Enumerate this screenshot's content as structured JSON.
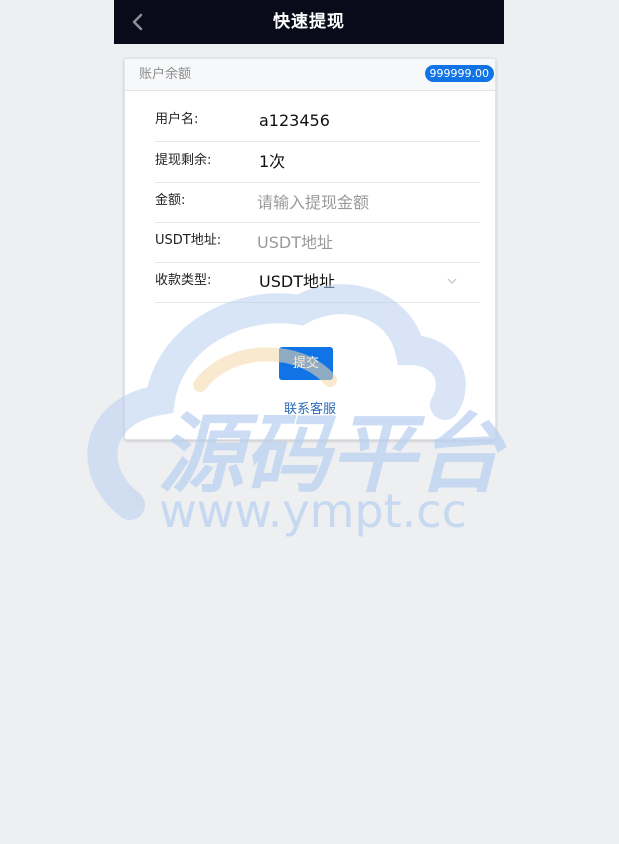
{
  "header": {
    "title": "快速提现",
    "back_icon": "chevron-left-icon"
  },
  "card": {
    "header_label": "账户余额",
    "balance": "999999.00"
  },
  "form": {
    "username": {
      "label": "用户名:",
      "value": "a123456"
    },
    "remaining": {
      "label": "提现剩余:",
      "value": "1次"
    },
    "amount": {
      "label": "金额:",
      "placeholder": "请输入提现金额",
      "value": ""
    },
    "usdt_address": {
      "label": "USDT地址:",
      "placeholder": "USDT地址",
      "value": ""
    },
    "payment_type": {
      "label": "收款类型:",
      "selected": "USDT地址",
      "icon": "chevron-down-icon"
    }
  },
  "actions": {
    "submit_label": "提交",
    "contact_label": "联系客服"
  },
  "watermark": {
    "brand": "源码平台",
    "url": "www.ympt.cc"
  },
  "colors": {
    "topbar_bg": "#090a1a",
    "accent": "#1174e6",
    "link": "#2a6bb8",
    "page_bg": "#eeeff1"
  }
}
